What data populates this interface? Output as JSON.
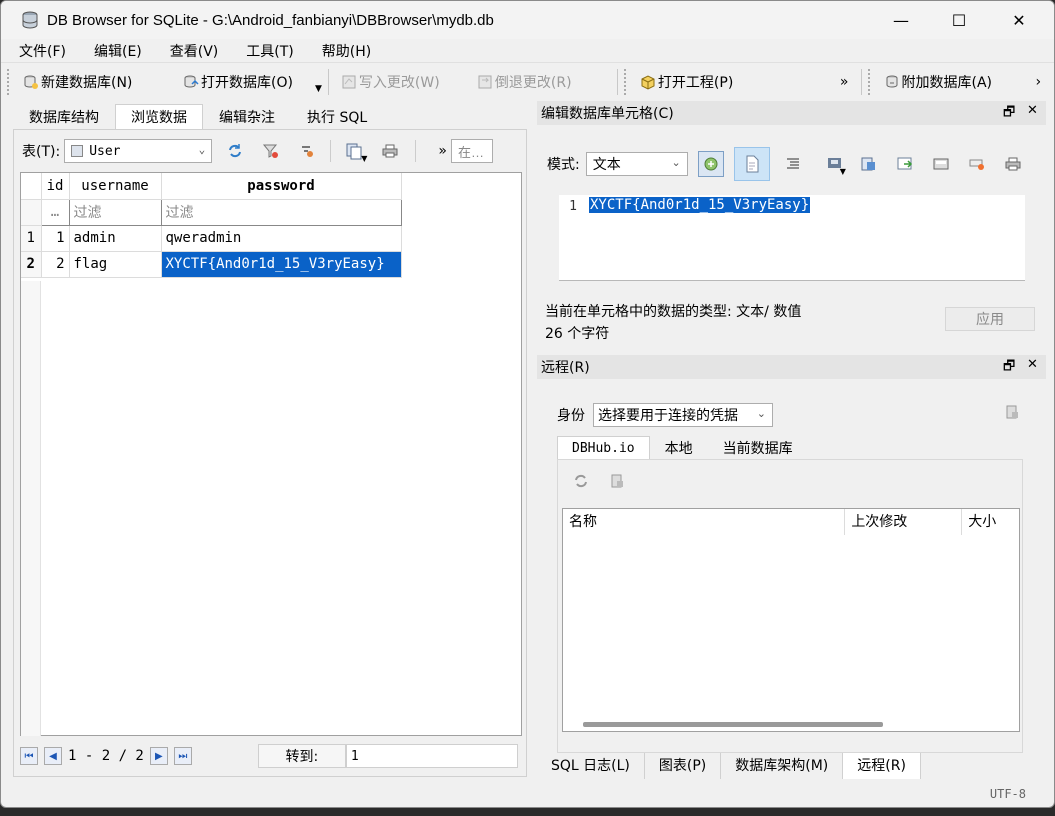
{
  "window": {
    "title": "DB Browser for SQLite - G:\\Android_fanbianyi\\DBBrowser\\mydb.db",
    "minimize": "—",
    "maximize": "☐",
    "close": "✕"
  },
  "menu": [
    {
      "label": "文件(F)"
    },
    {
      "label": "编辑(E)"
    },
    {
      "label": "查看(V)"
    },
    {
      "label": "工具(T)"
    },
    {
      "label": "帮助(H)"
    }
  ],
  "toolbar": {
    "new_db": "新建数据库(N)",
    "open_db": "打开数据库(O)",
    "write_changes": "写入更改(W)",
    "revert_changes": "倒退更改(R)",
    "open_project": "打开工程(P)",
    "attach_db": "附加数据库(A)",
    "more1": "»",
    "more2": "›"
  },
  "left_tabs": [
    "数据库结构",
    "浏览数据",
    "编辑杂注",
    "执行 SQL"
  ],
  "browse": {
    "table_label": "表(T):",
    "table_value": "User",
    "find_label": "在…",
    "more": "»",
    "columns": [
      "id",
      "username",
      "password"
    ],
    "filter_corner": "…",
    "filter_placeholder": "过滤",
    "rows": [
      {
        "rownum": "1",
        "id": "1",
        "username": "admin",
        "password": "qweradmin"
      },
      {
        "rownum": "2",
        "id": "2",
        "username": "flag",
        "password": "XYCTF{And0r1d_15_V3ryEasy}"
      }
    ],
    "pager_text": "1 - 2 / 2",
    "goto_label": "转到:",
    "goto_value": "1"
  },
  "edit_cell": {
    "title": "编辑数据库单元格(C)",
    "mode_label": "模式:",
    "mode_value": "文本",
    "line_number": "1",
    "content": "XYCTF{And0r1d_15_V3ryEasy}",
    "type_info": "当前在单元格中的数据的类型: 文本/ 数值",
    "char_count": "26 个字符",
    "apply": "应用"
  },
  "remote": {
    "title": "远程(R)",
    "identity_label": "身份",
    "identity_value": "选择要用于连接的凭据",
    "tabs": [
      "DBHub.io",
      "本地",
      "当前数据库"
    ],
    "columns": [
      "名称",
      "上次修改",
      "大小"
    ]
  },
  "bottom_tabs": [
    "SQL 日志(L)",
    "图表(P)",
    "数据库架构(M)",
    "远程(R)"
  ],
  "status": {
    "encoding": "UTF-8"
  },
  "dock_float": "🗗",
  "dock_close": "✕",
  "colors": {
    "selection": "#0a62c8",
    "window_bg": "#f0f0f0"
  }
}
